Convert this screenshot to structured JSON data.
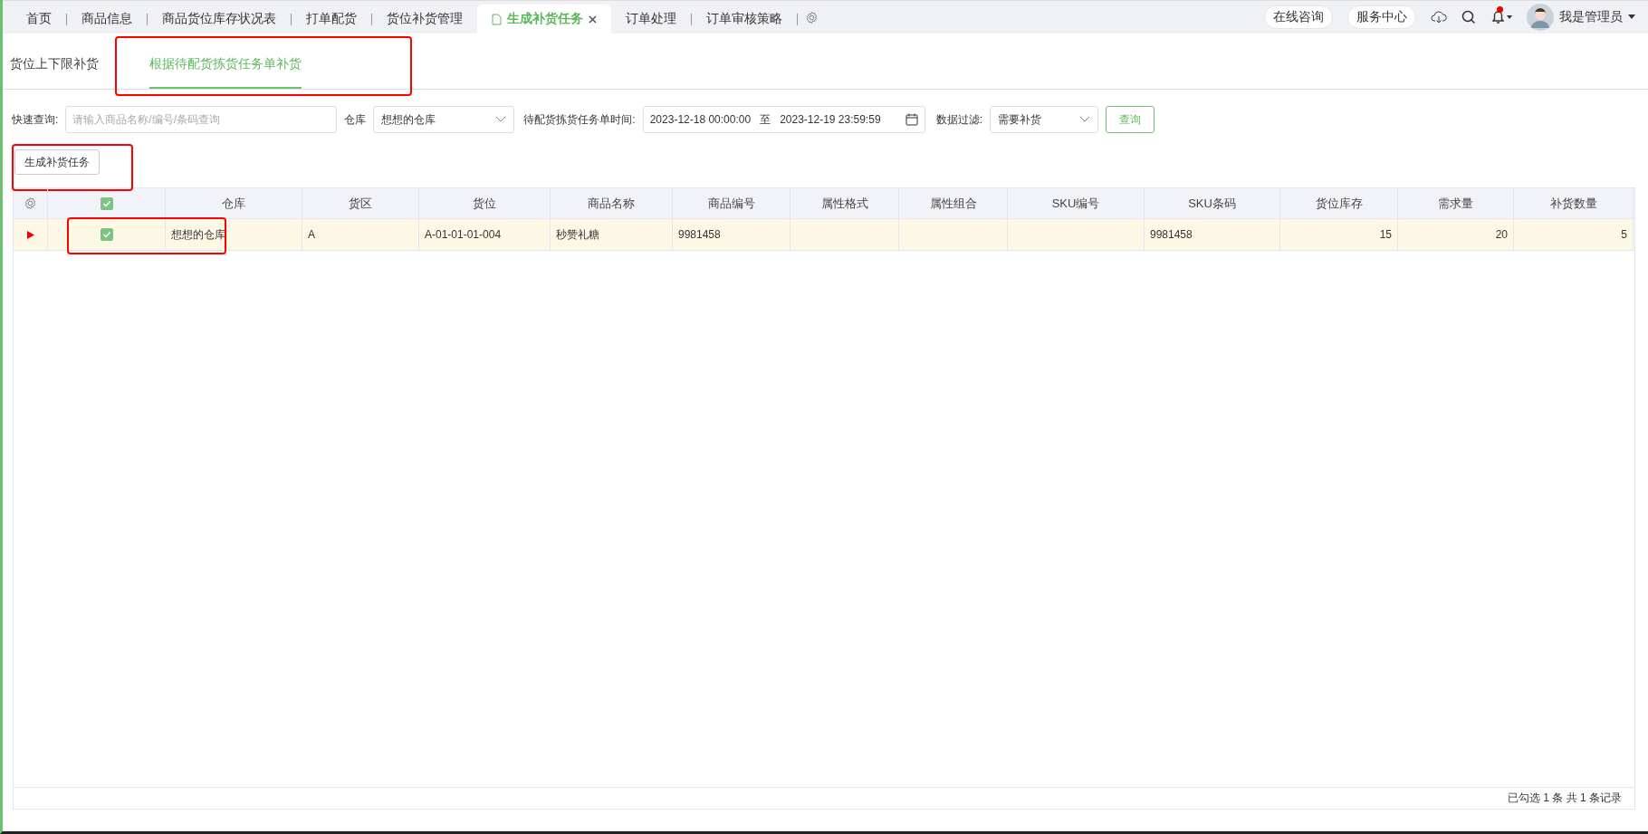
{
  "top_tabs": [
    {
      "label": "首页",
      "selected": false
    },
    {
      "label": "商品信息",
      "selected": false
    },
    {
      "label": "商品货位库存状况表",
      "selected": false
    },
    {
      "label": "打单配货",
      "selected": false
    },
    {
      "label": "货位补货管理",
      "selected": false
    },
    {
      "label": "生成补货任务",
      "selected": true
    },
    {
      "label": "订单处理",
      "selected": false
    },
    {
      "label": "订单审核策略",
      "selected": false
    }
  ],
  "header": {
    "buttons": [
      "在线咨询",
      "服务中心"
    ],
    "notification_dot": true,
    "user": "我是管理员"
  },
  "sub_tabs": [
    {
      "label": "货位上下限补货",
      "selected": false,
      "highlighted": false
    },
    {
      "label": "根据待配货拣货任务单补货",
      "selected": true,
      "highlighted": true
    }
  ],
  "filters": {
    "quick_label": "快速查询:",
    "quick_placeholder": "请输入商品名称/编号/条码查询",
    "warehouse_label": "仓库",
    "warehouse_value": "想想的仓库",
    "time_label": "待配货拣货任务单时间:",
    "time_start": "2023-12-18 00:00:00",
    "time_sep": "至",
    "time_end": "2023-12-19 23:59:59",
    "filter_label": "数据过滤:",
    "filter_value": "需要补货",
    "query_button": "查询"
  },
  "generate_button": {
    "label": "生成补货任务",
    "highlighted": true
  },
  "table": {
    "header_checked": true,
    "columns": [
      {
        "label": "仓库",
        "kind": "text"
      },
      {
        "label": "货区",
        "kind": "text"
      },
      {
        "label": "货位",
        "kind": "text"
      },
      {
        "label": "商品名称",
        "kind": "text"
      },
      {
        "label": "商品编号",
        "kind": "text"
      },
      {
        "label": "属性格式",
        "kind": "text"
      },
      {
        "label": "属性组合",
        "kind": "text"
      },
      {
        "label": "SKU编号",
        "kind": "text"
      },
      {
        "label": "SKU条码",
        "kind": "text"
      },
      {
        "label": "货位库存",
        "kind": "number"
      },
      {
        "label": "需求量",
        "kind": "number"
      },
      {
        "label": "补货数量",
        "kind": "number"
      }
    ],
    "rows": [
      {
        "current": true,
        "checked": true,
        "highlighted": true,
        "cells": [
          "想想的仓库",
          "A",
          "A-01-01-01-004",
          "秒赞礼糖",
          "9981458",
          "",
          "",
          "",
          "9981458",
          "15",
          "20",
          "5"
        ]
      }
    ]
  },
  "footer": {
    "summary": "已勾选 1 条  共 1 条记录"
  }
}
